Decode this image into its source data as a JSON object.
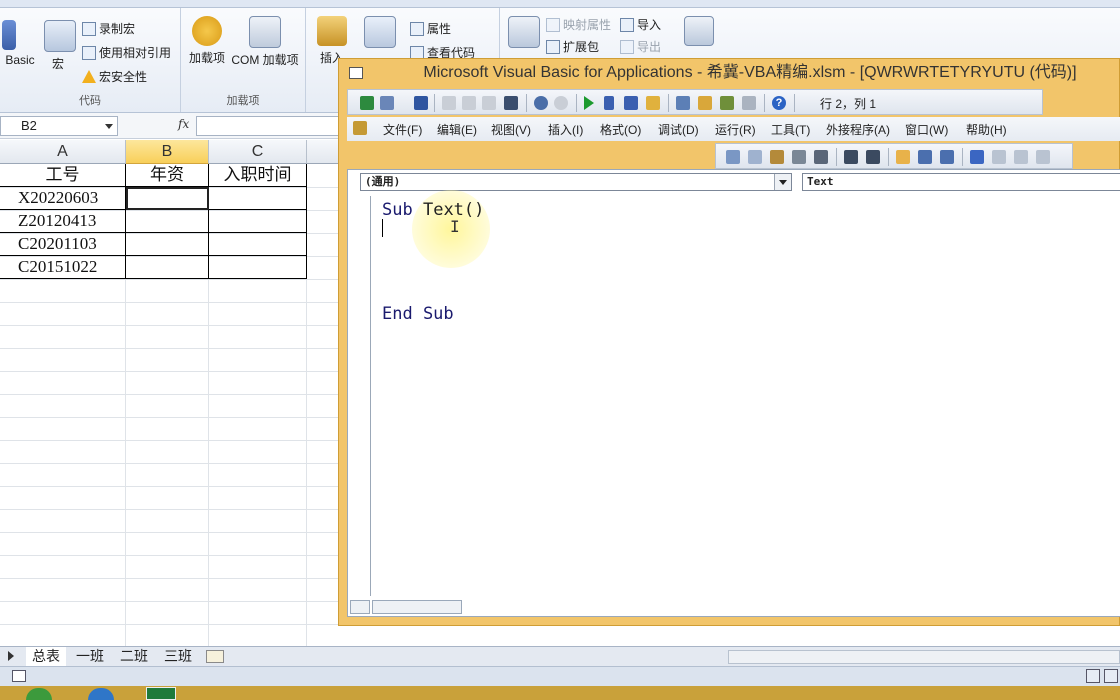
{
  "ribbon": {
    "code_group": {
      "basic_label": "Basic",
      "macro_label": "宏",
      "record_macro": "录制宏",
      "relative_ref": "使用相对引用",
      "macro_security": "宏安全性",
      "group_label": "代码"
    },
    "addins_group": {
      "addins_label": "加载项",
      "com_addins_label": "COM 加载项",
      "group_label": "加载项"
    },
    "controls_group": {
      "insert_label": "插入",
      "properties": "属性",
      "view_code": "查看代码"
    },
    "xml_group": {
      "map_properties": "映射属性",
      "expansion_packs": "扩展包",
      "import": "导入",
      "export": "导出"
    }
  },
  "formula_bar": {
    "name_box": "B2",
    "fx": "fx",
    "formula": ""
  },
  "sheet": {
    "columns": [
      "A",
      "B",
      "C"
    ],
    "selected_column": "B",
    "header_row": [
      "工号",
      "年资",
      "入职时间"
    ],
    "rows": [
      [
        "X20220603",
        "",
        ""
      ],
      [
        "Z20120413",
        "",
        ""
      ],
      [
        "C20201103",
        "",
        ""
      ],
      [
        "C20151022",
        "",
        ""
      ]
    ]
  },
  "sheet_tabs": [
    "总表",
    "一班",
    "二班",
    "三班"
  ],
  "vba": {
    "title": "Microsoft Visual Basic for Applications - 希冀-VBA精编.xlsm - [QWRWRTETYRYUTU (代码)]",
    "position": "行 2，列 1",
    "menu": [
      "文件(F)",
      "编辑(E)",
      "视图(V)",
      "插入(I)",
      "格式(O)",
      "调试(D)",
      "运行(R)",
      "工具(T)",
      "外接程序(A)",
      "窗口(W)",
      "帮助(H)"
    ],
    "object_dropdown": "(通用)",
    "procedure_dropdown": "Text",
    "code": {
      "line1_keyword": "Sub",
      "line1_name": "Text",
      "line1_parens": "()",
      "line_end": "End Sub"
    }
  },
  "colors": {
    "vba_frame": "#f2c56a",
    "selected_header": "#f8cf5a",
    "code_keyword": "#1a1a6e",
    "highlight": "#fff696"
  }
}
